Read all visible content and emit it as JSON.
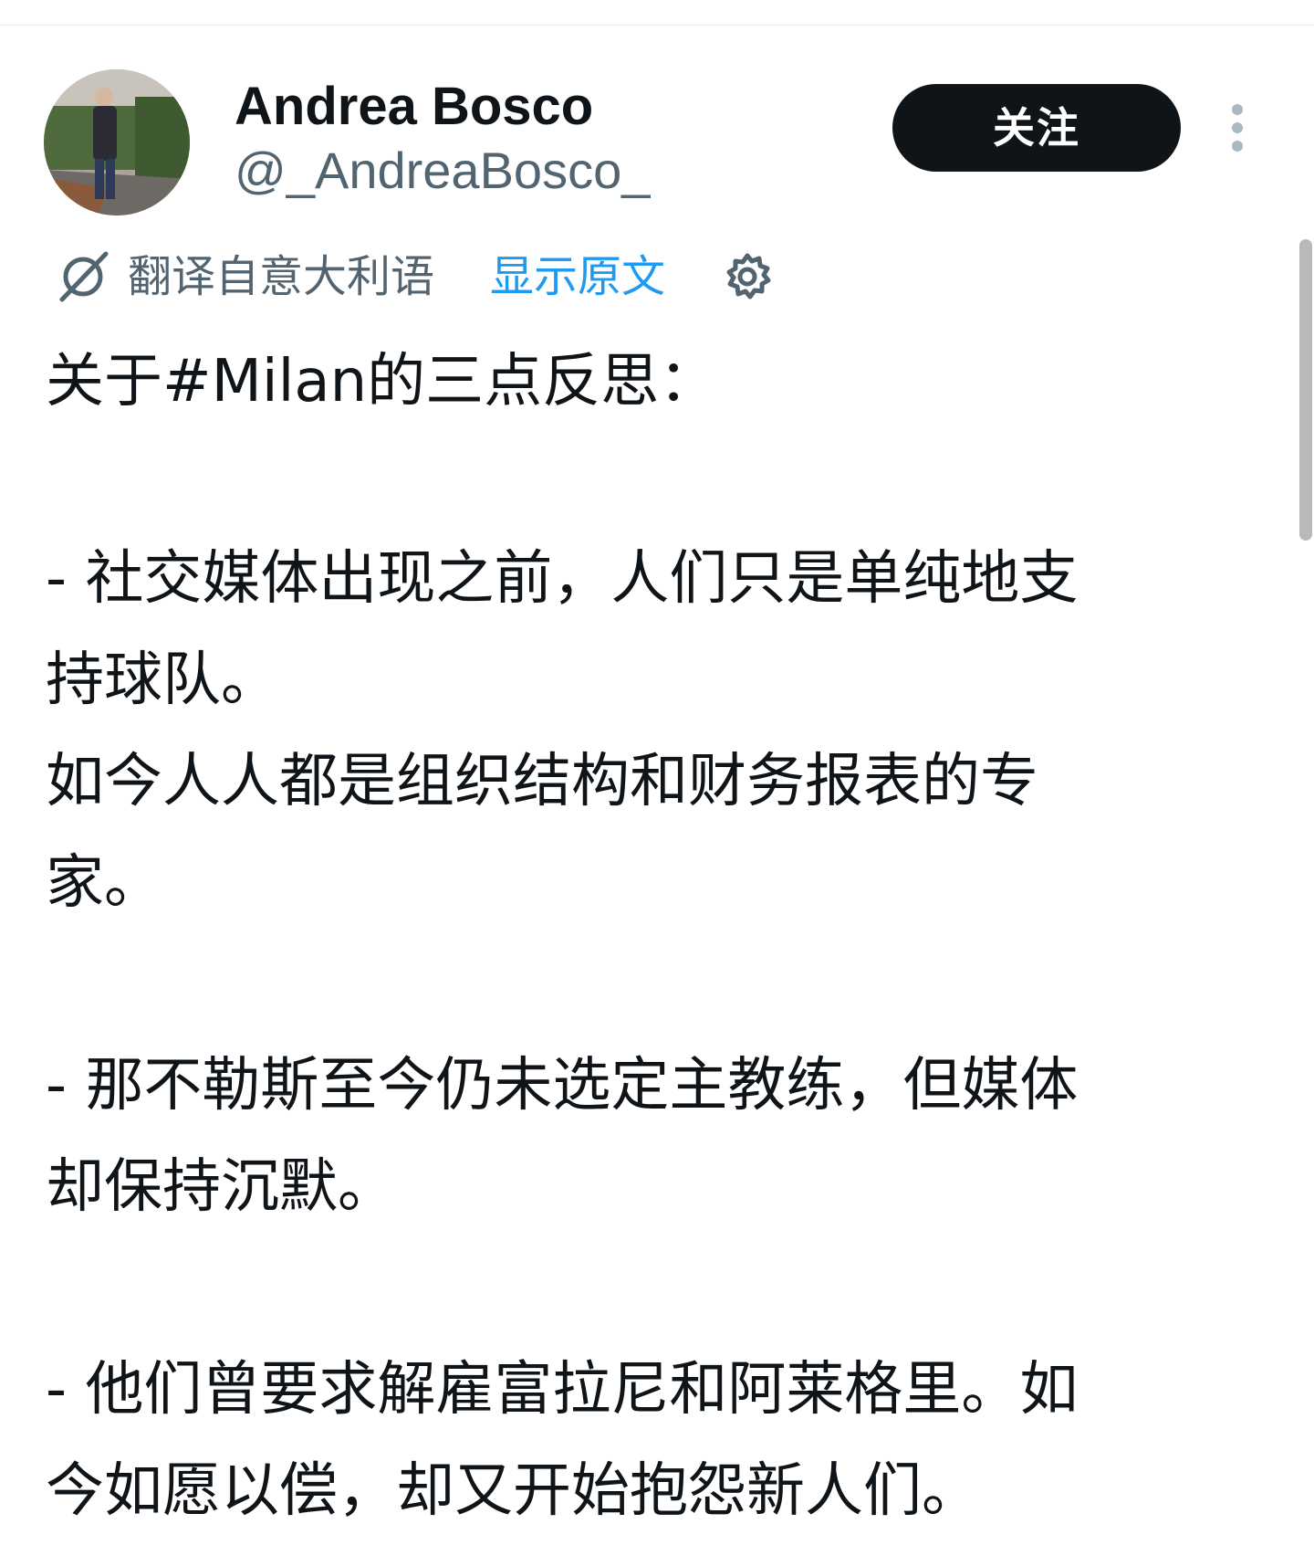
{
  "user": {
    "display_name": "Andrea Bosco",
    "handle": "@_AndreaBosco_"
  },
  "actions": {
    "follow_label": "关注"
  },
  "icons": {
    "more": "more-vertical-icon",
    "translate": "translate-icon",
    "settings": "gear-icon"
  },
  "translation": {
    "label": "翻译自意大利语",
    "show_original": "显示原文"
  },
  "tweet": {
    "heading": "关于#Milan的三点反思：",
    "point1_line1": "- 社交媒体出现之前，人们只是单纯地支",
    "point1_line2": "持球队。",
    "point1_line3": "如今人人都是组织结构和财务报表的专",
    "point1_line4": "家。",
    "point2_line1": "- 那不勒斯至今仍未选定主教练，但媒体",
    "point2_line2": "却保持沉默。",
    "point3_line1": "- 他们曾要求解雇富拉尼和阿莱格里。如",
    "point3_line2": "今如愿以偿，却又开始抱怨新人们。"
  },
  "colors": {
    "text": "#0f1419",
    "secondary": "#536471",
    "link": "#1d9bf0",
    "button_bg": "#0f1419",
    "button_text": "#ffffff"
  }
}
